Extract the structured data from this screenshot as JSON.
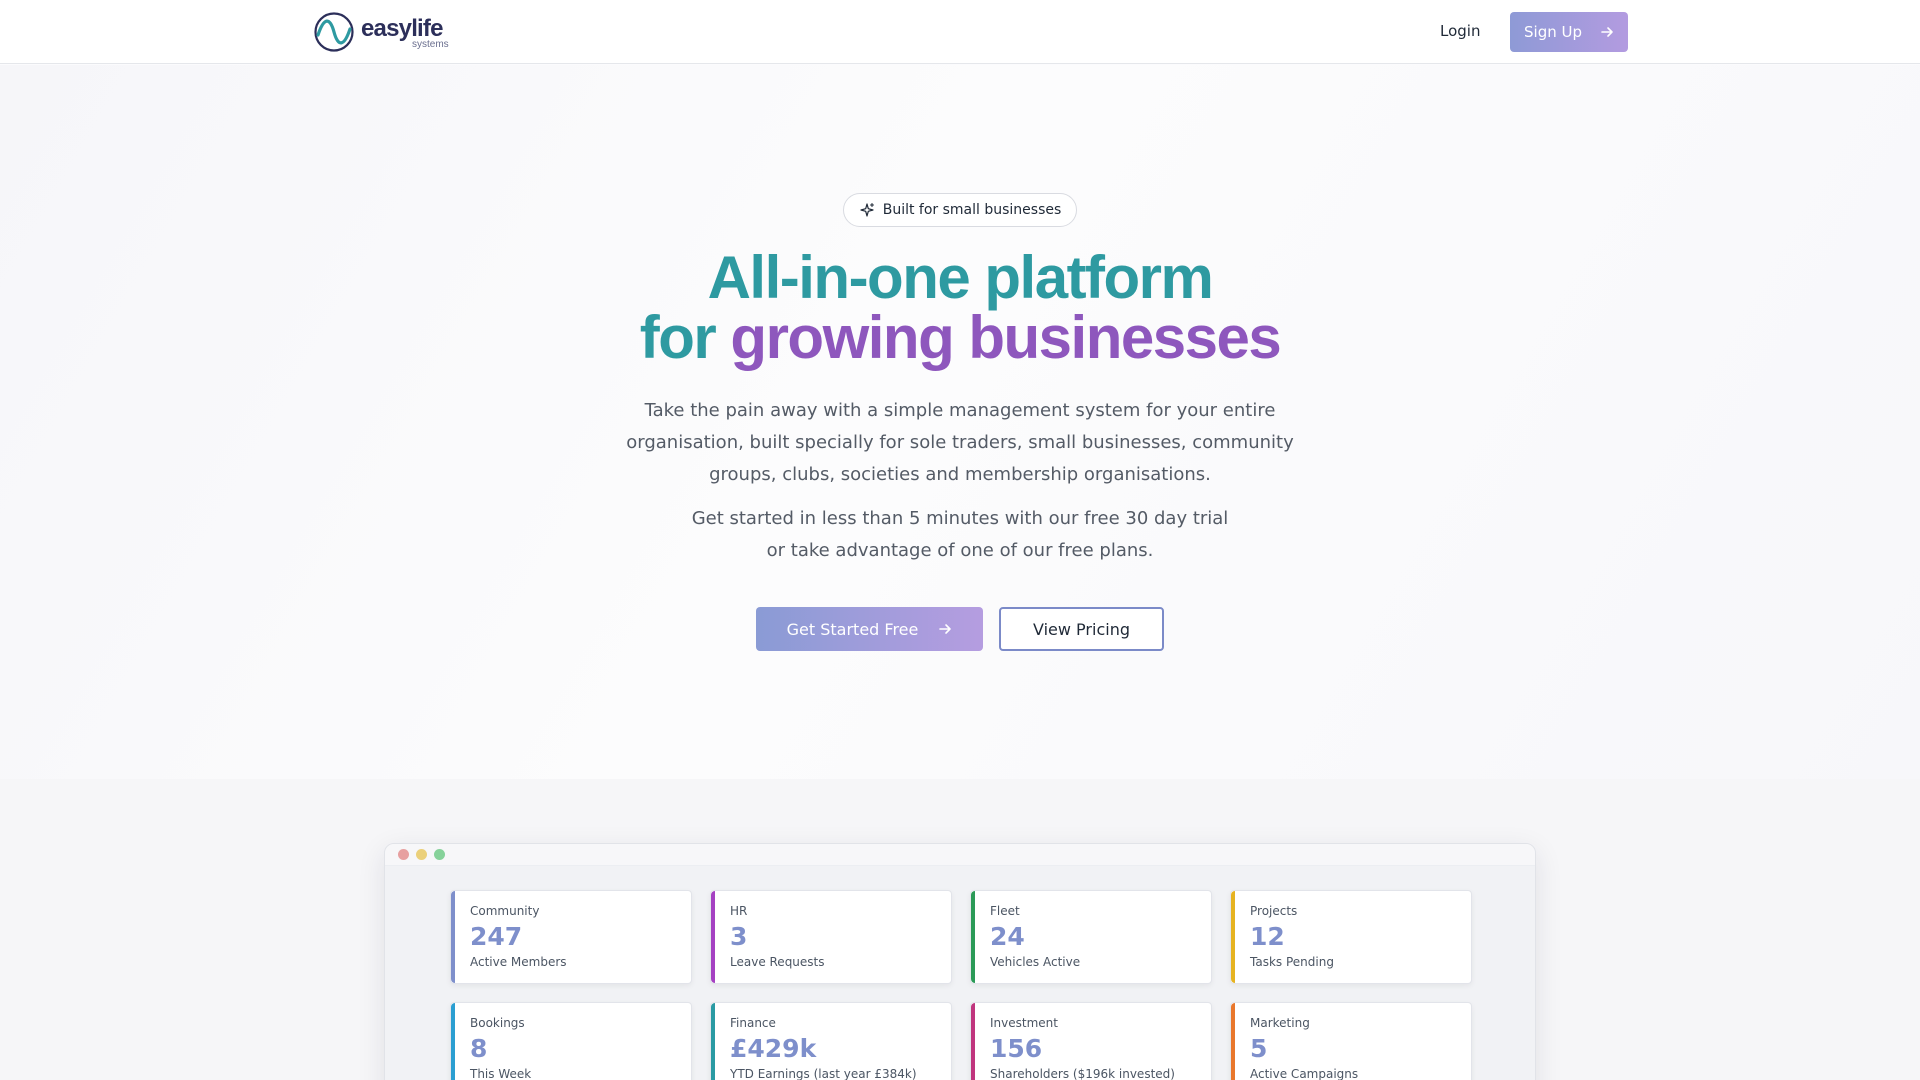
{
  "brand": {
    "name": "easylife",
    "tagline": "systems"
  },
  "nav": {
    "login_label": "Login",
    "signup_label": "Sign Up"
  },
  "hero": {
    "badge": "Built for small businesses",
    "headline_line1": "All-in-one platform",
    "headline_line2_prefix": "for",
    "headline_line2_highlight": "growing businesses",
    "description": "Take the pain away with a simple management system for your entire organisation, built specially for sole traders, small businesses, community groups, clubs, societies and membership organisations.",
    "trial_line1": "Get started in less than 5 minutes with our free 30 day trial",
    "trial_line2": "or take advantage of one of our free plans.",
    "cta_primary": "Get Started Free",
    "cta_secondary": "View Pricing"
  },
  "dashboard": {
    "cards": [
      {
        "category": "Community",
        "value": "247",
        "label": "Active Members",
        "accent": "#7e8fcb"
      },
      {
        "category": "HR",
        "value": "3",
        "label": "Leave Requests",
        "accent": "#a541c2"
      },
      {
        "category": "Fleet",
        "value": "24",
        "label": "Vehicles Active",
        "accent": "#2b9a57"
      },
      {
        "category": "Projects",
        "value": "12",
        "label": "Tasks Pending",
        "accent": "#e6b321"
      },
      {
        "category": "Bookings",
        "value": "8",
        "label": "This Week",
        "accent": "#2b9ed1"
      },
      {
        "category": "Finance",
        "value": "£429k",
        "label": "YTD Earnings (last year £384k)",
        "accent": "#2a9aa3"
      },
      {
        "category": "Investment",
        "value": "156",
        "label": "Shareholders ($196k invested)",
        "accent": "#c0357e"
      },
      {
        "category": "Marketing",
        "value": "5",
        "label": "Active Campaigns",
        "accent": "#e9772c"
      }
    ]
  },
  "colors": {
    "teal": "#2e9aa1",
    "purple": "#8e57bd",
    "button_gradient_start": "#8a9bd5",
    "button_gradient_end": "#b59de0"
  }
}
